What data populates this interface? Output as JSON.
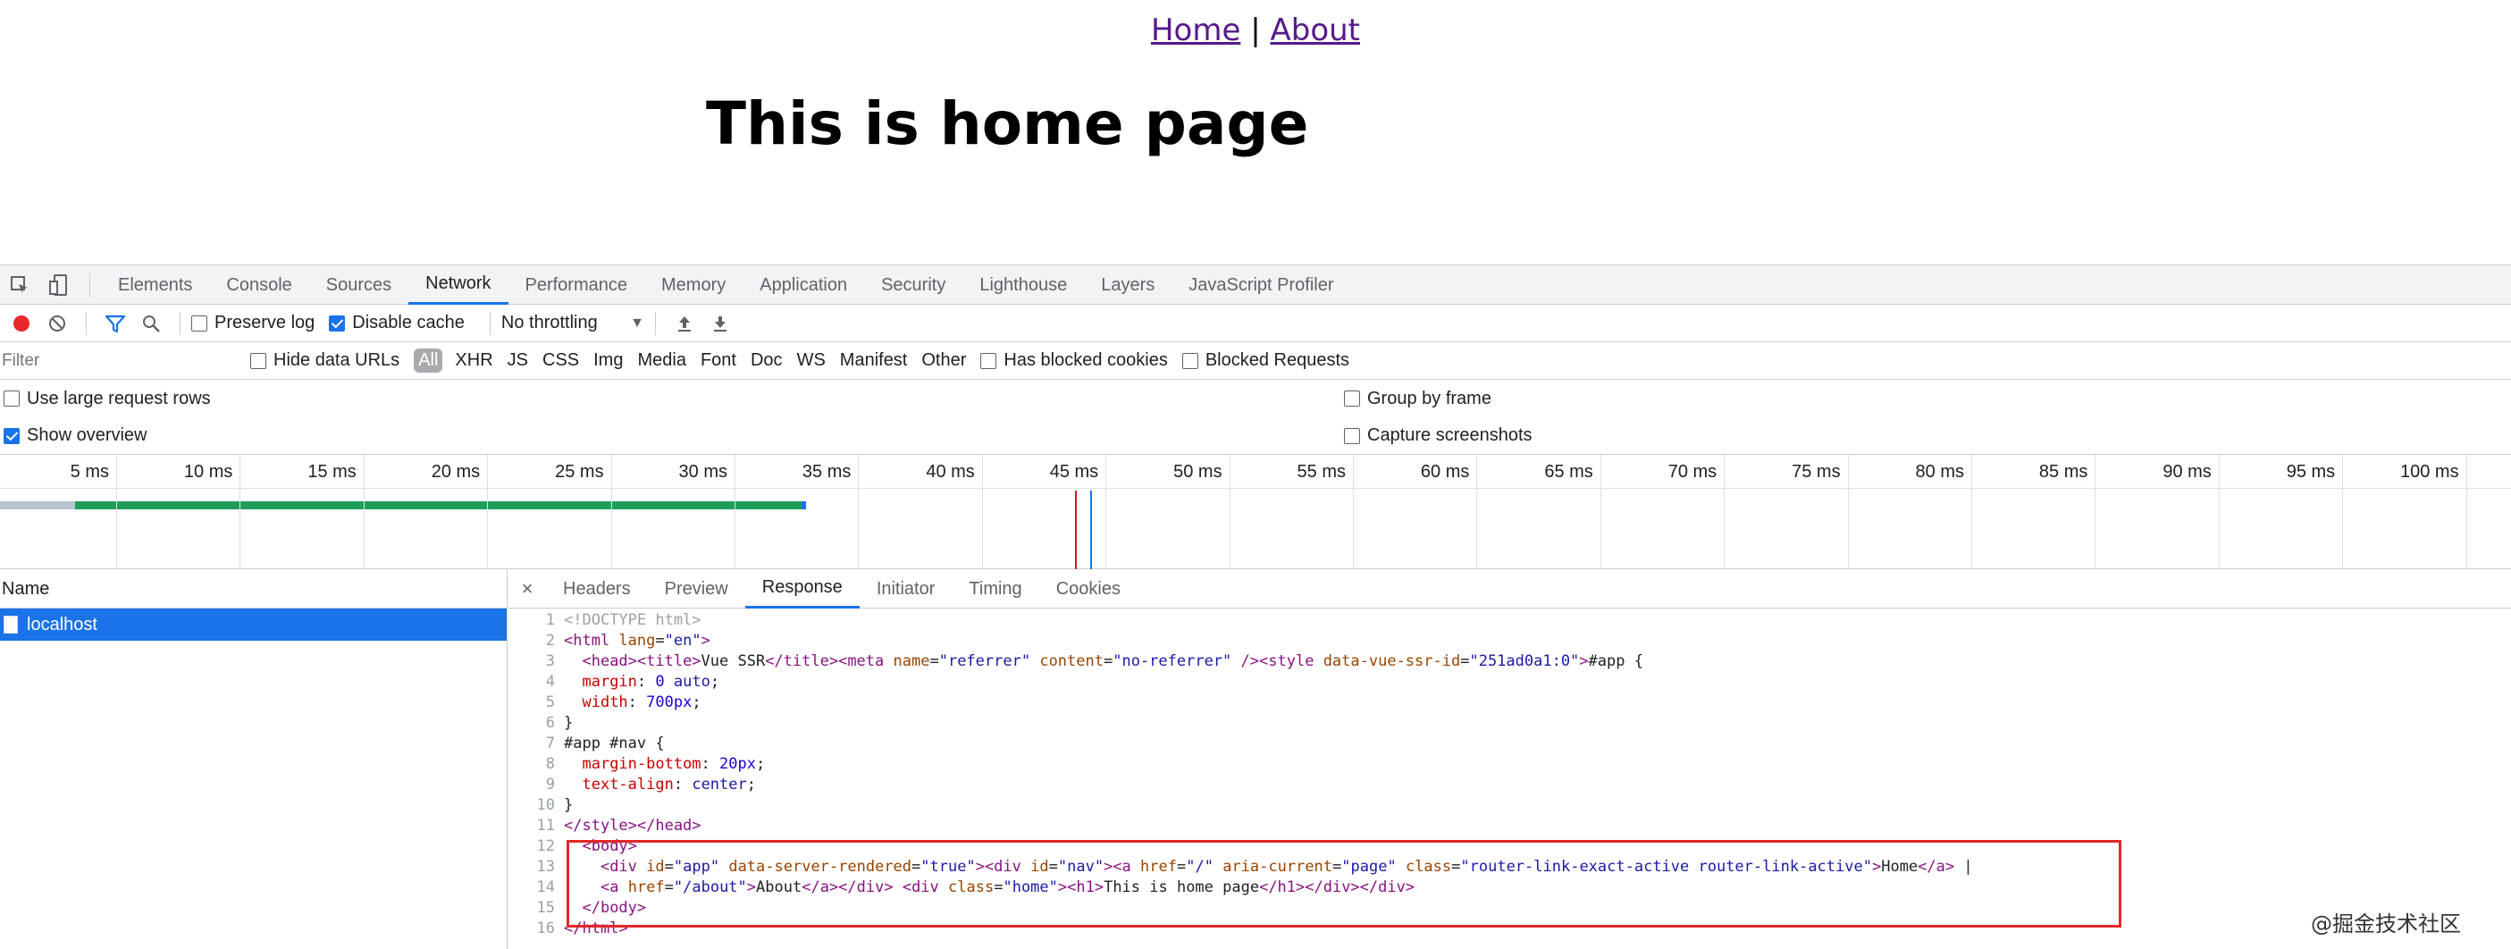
{
  "page": {
    "nav_home": "Home",
    "nav_sep": "|",
    "nav_about": "About",
    "heading": "This is home page"
  },
  "devtools": {
    "tabs": [
      "Elements",
      "Console",
      "Sources",
      "Network",
      "Performance",
      "Memory",
      "Application",
      "Security",
      "Lighthouse",
      "Layers",
      "JavaScript Profiler"
    ],
    "active_tab": "Network",
    "toolbar": {
      "preserve_log": "Preserve log",
      "preserve_log_checked": false,
      "disable_cache": "Disable cache",
      "disable_cache_checked": true,
      "throttling": "No throttling"
    },
    "filter": {
      "placeholder": "Filter",
      "hide_data_urls": "Hide data URLs",
      "types": [
        "All",
        "XHR",
        "JS",
        "CSS",
        "Img",
        "Media",
        "Font",
        "Doc",
        "WS",
        "Manifest",
        "Other"
      ],
      "has_blocked_cookies": "Has blocked cookies",
      "blocked_requests": "Blocked Requests"
    },
    "settings": {
      "large_rows": "Use large request rows",
      "show_overview": "Show overview",
      "group_by_frame": "Group by frame",
      "capture_screenshots": "Capture screenshots"
    },
    "overview_ticks": [
      "5 ms",
      "10 ms",
      "15 ms",
      "20 ms",
      "25 ms",
      "30 ms",
      "35 ms",
      "40 ms",
      "45 ms",
      "50 ms",
      "55 ms",
      "60 ms",
      "65 ms",
      "70 ms",
      "75 ms",
      "80 ms",
      "85 ms",
      "90 ms",
      "95 ms",
      "100 ms"
    ],
    "name_header": "Name",
    "request_name": "localhost",
    "detail_tabs": [
      "Headers",
      "Preview",
      "Response",
      "Initiator",
      "Timing",
      "Cookies"
    ],
    "active_detail_tab": "Response",
    "close_label": "×",
    "code_lines": [
      "1",
      "2",
      "3",
      "4",
      "5",
      "6",
      "7",
      "8",
      "9",
      "10",
      "11",
      "12",
      "13",
      "14",
      "15",
      "16"
    ]
  },
  "watermark": "@掘金技术社区",
  "colors": {
    "accent": "#1a73e8",
    "record": "#e8282b",
    "highlight_box": "#e02828",
    "bar_green": "#1e9e5a",
    "bar_blue": "#1a73e8"
  }
}
